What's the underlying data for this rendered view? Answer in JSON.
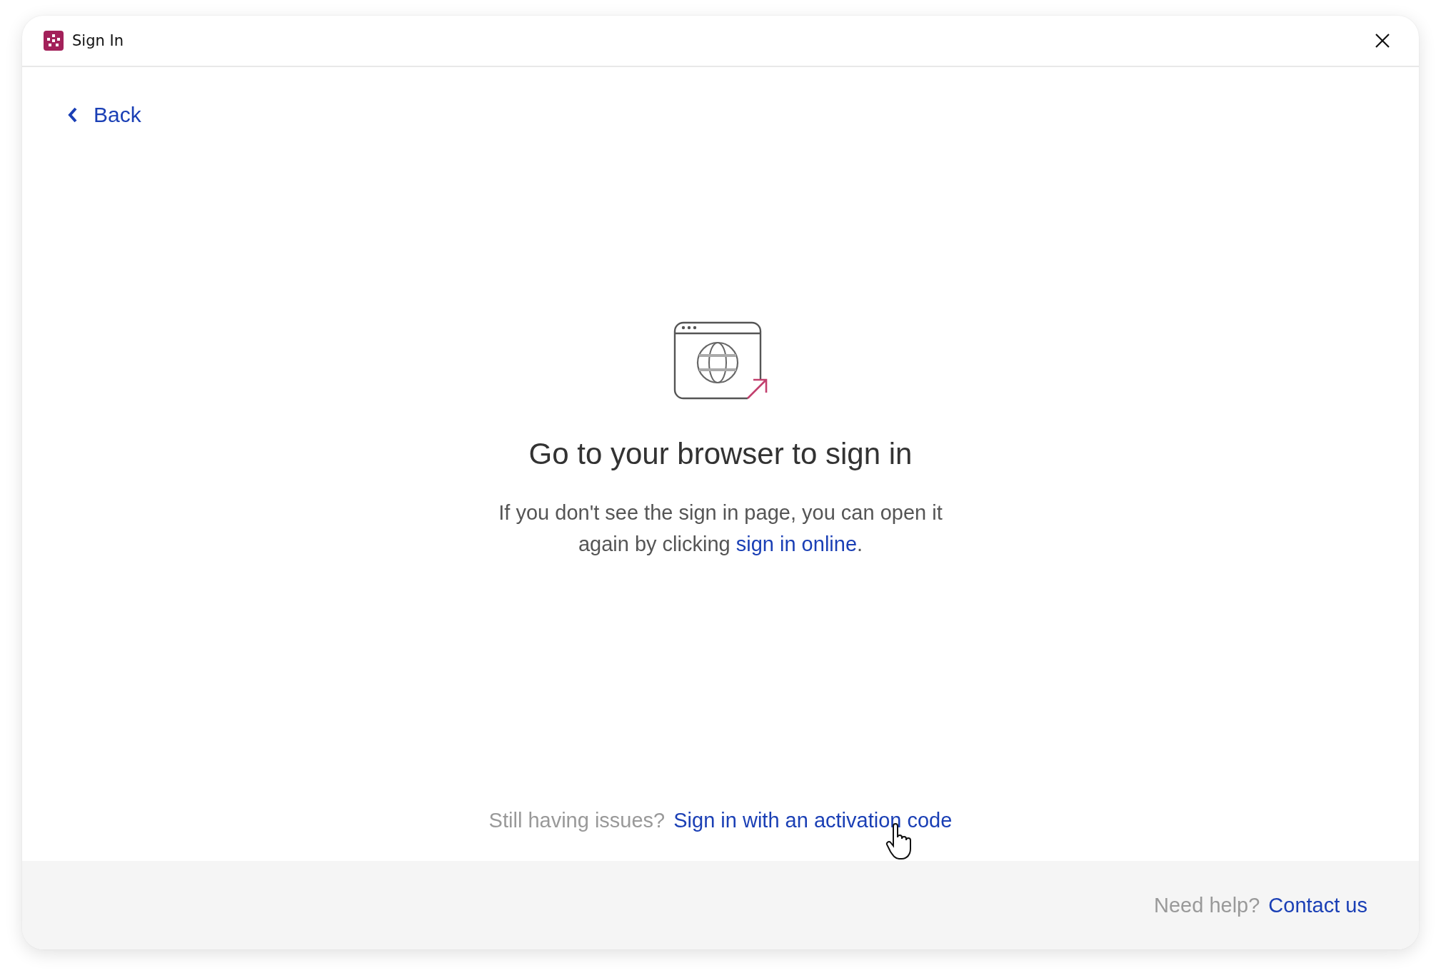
{
  "window": {
    "title": "Sign In"
  },
  "back_link": {
    "label": "Back"
  },
  "heading": "Go to your browser to sign in",
  "message": {
    "text": "If you don't see the sign in page, you can open it again by clicking ",
    "link": "sign in online",
    "end": "."
  },
  "issues": {
    "prompt": "Still having issues?",
    "link": "Sign in with an activation code"
  },
  "footer": {
    "prompt": "Need help?",
    "link": "Contact us"
  }
}
